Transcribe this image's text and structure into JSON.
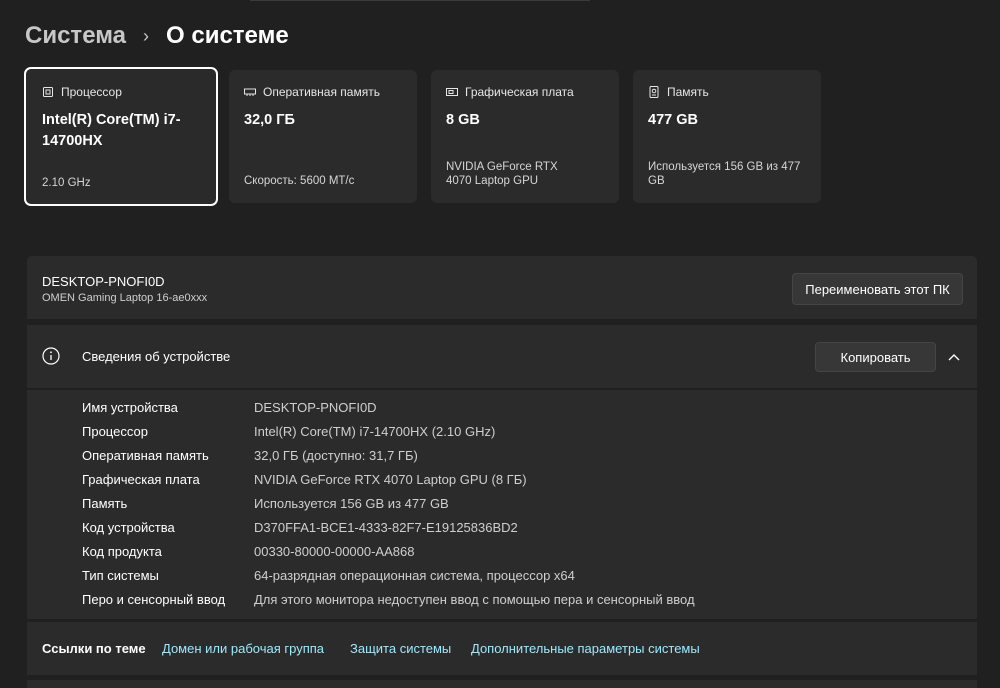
{
  "breadcrumb": {
    "parent": "Система",
    "separator": "›",
    "current": "О системе"
  },
  "cards": [
    {
      "icon": "processor-icon",
      "title": "Процессор",
      "value": "Intel(R) Core(TM) i7-14700HX",
      "sub": "2.10 GHz"
    },
    {
      "icon": "ram-icon",
      "title": "Оперативная память",
      "value": "32,0 ГБ",
      "sub": "Скорость: 5600 МТ/с"
    },
    {
      "icon": "gpu-icon",
      "title": "Графическая плата",
      "value": "8 GB",
      "sub": "NVIDIA GeForce RTX 4070 Laptop GPU"
    },
    {
      "icon": "storage-icon",
      "title": "Память",
      "value": "477 GB",
      "sub": "Используется 156 GB из 477 GB"
    }
  ],
  "pc": {
    "name": "DESKTOP-PNOFI0D",
    "model": "OMEN Gaming Laptop 16-ae0xxx",
    "rename_label": "Переименовать этот ПК"
  },
  "device_specs": {
    "title": "Сведения об устройстве",
    "copy_label": "Копировать",
    "rows": [
      {
        "key": "Имя устройства",
        "value": "DESKTOP-PNOFI0D"
      },
      {
        "key": "Процессор",
        "value": "Intel(R) Core(TM) i7-14700HX (2.10 GHz)"
      },
      {
        "key": "Оперативная память",
        "value": "32,0 ГБ (доступно: 31,7 ГБ)"
      },
      {
        "key": "Графическая плата",
        "value": "NVIDIA GeForce RTX 4070 Laptop GPU (8 ГБ)"
      },
      {
        "key": "Память",
        "value": "Используется 156 GB из 477 GB"
      },
      {
        "key": "Код устройства",
        "value": "D370FFA1-BCE1-4333-82F7-E19125836BD2"
      },
      {
        "key": "Код продукта",
        "value": "00330-80000-00000-AA868"
      },
      {
        "key": "Тип системы",
        "value": "64-разрядная операционная система, процессор x64"
      },
      {
        "key": "Перо и сенсорный ввод",
        "value": "Для этого монитора недоступен ввод с помощью пера и сенсорный ввод"
      }
    ]
  },
  "related_links": {
    "label": "Ссылки по теме",
    "links": [
      "Домен или рабочая группа",
      "Защита системы",
      "Дополнительные параметры системы"
    ]
  },
  "colors": {
    "background": "#202020",
    "card": "#2b2b2b",
    "link": "#99ebff"
  }
}
